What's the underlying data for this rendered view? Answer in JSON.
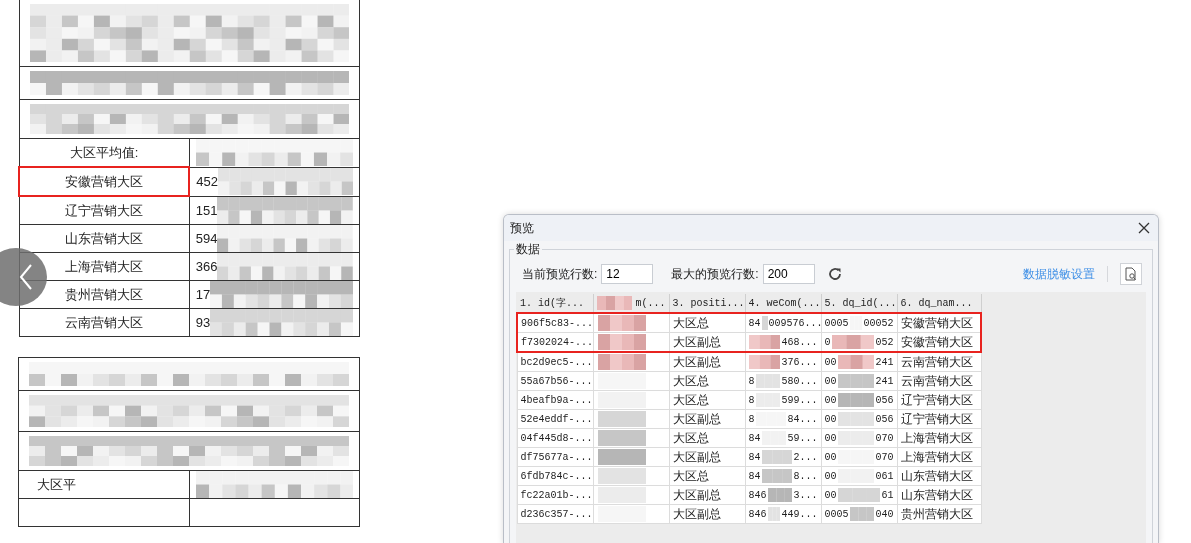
{
  "document": {
    "average_label": "大区平均值:",
    "rows": [
      {
        "region": "安徽营销大区",
        "value": "452",
        "highlighted": true
      },
      {
        "region": "辽宁营销大区",
        "value": "151",
        "highlighted": false
      },
      {
        "region": "山东营销大区",
        "value": "594",
        "highlighted": false
      },
      {
        "region": "上海营销大区",
        "value": "366",
        "highlighted": false
      },
      {
        "region": "贵州营销大区",
        "value": "17",
        "highlighted": false
      },
      {
        "region": "云南营销大区",
        "value": "93",
        "highlighted": false
      }
    ],
    "second_table": {
      "average_label": "大区平"
    }
  },
  "dialog": {
    "title": "预览",
    "group_label": "数据",
    "current_rows_label": "当前预览行数:",
    "current_rows": "12",
    "max_rows_label": "最大的预览行数:",
    "max_rows": "200",
    "masking_link": "数据脱敏设置",
    "columns": [
      "1. id(字...",
      "m(...",
      "3. positi...",
      "4. weCom(...",
      "5. dq_id(...",
      "6. dq_nam..."
    ],
    "rows": [
      {
        "id": "906f5c83-...",
        "position": "大区总",
        "wecom": {
          "head": "84",
          "tail": "009576..."
        },
        "dq_id": {
          "head": "0005",
          "tail": "00052"
        },
        "dq_name": "安徽营销大区",
        "highlighted": true
      },
      {
        "id": "f7302024-...",
        "position": "大区副总",
        "wecom": {
          "tail": "468..."
        },
        "dq_id": {
          "head": "0",
          "tail": "052"
        },
        "dq_name": "安徽营销大区",
        "highlighted": true
      },
      {
        "id": "bc2d9ec5-...",
        "position": "大区副总",
        "wecom": {
          "tail": "376..."
        },
        "dq_id": {
          "head": "00",
          "tail": "241"
        },
        "dq_name": "云南营销大区",
        "highlighted": false
      },
      {
        "id": "55a67b56-...",
        "position": "大区总",
        "wecom": {
          "head": "8",
          "tail": "580..."
        },
        "dq_id": {
          "head": "00",
          "tail": "241"
        },
        "dq_name": "云南营销大区",
        "highlighted": false
      },
      {
        "id": "4beafb9a-...",
        "position": "大区总",
        "wecom": {
          "head": "8",
          "tail": "599..."
        },
        "dq_id": {
          "head": "00",
          "tail": "056"
        },
        "dq_name": "辽宁营销大区",
        "highlighted": false
      },
      {
        "id": "52e4eddf-...",
        "position": "大区副总",
        "wecom": {
          "head": "8",
          "tail": "84..."
        },
        "dq_id": {
          "head": "00",
          "tail": "056"
        },
        "dq_name": "辽宁营销大区",
        "highlighted": false
      },
      {
        "id": "04f445d8-...",
        "position": "大区总",
        "wecom": {
          "head": "84",
          "tail": "59..."
        },
        "dq_id": {
          "head": "00",
          "tail": "070"
        },
        "dq_name": "上海营销大区",
        "highlighted": false
      },
      {
        "id": "df75677a-...",
        "position": "大区副总",
        "wecom": {
          "head": "84",
          "tail": "2..."
        },
        "dq_id": {
          "head": "00",
          "tail": "070"
        },
        "dq_name": "上海营销大区",
        "highlighted": false
      },
      {
        "id": "6fdb784c-...",
        "position": "大区总",
        "wecom": {
          "head": "84",
          "tail": "8..."
        },
        "dq_id": {
          "head": "00",
          "tail": "061"
        },
        "dq_name": "山东营销大区",
        "highlighted": false
      },
      {
        "id": "fc22a01b-...",
        "position": "大区副总",
        "wecom": {
          "head": "846",
          "tail": "3..."
        },
        "dq_id": {
          "head": "00",
          "tail": "61"
        },
        "dq_name": "山东营销大区",
        "highlighted": false
      },
      {
        "id": "d236c357-...",
        "position": "大区副总",
        "wecom": {
          "head": "846",
          "tail": "449..."
        },
        "dq_id": {
          "head": "0005",
          "tail": "040"
        },
        "dq_name": "贵州营销大区",
        "highlighted": false
      }
    ]
  }
}
